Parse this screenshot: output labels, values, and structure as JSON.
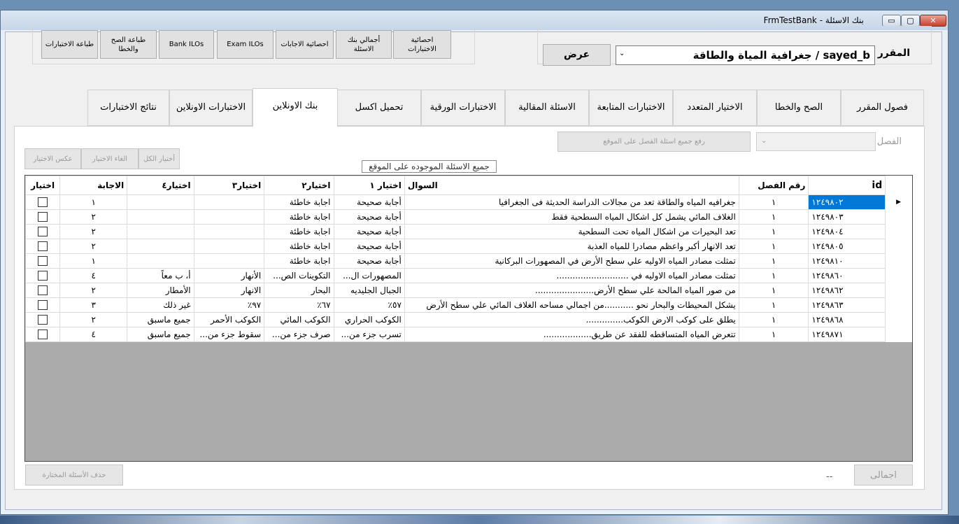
{
  "window": {
    "title": "FrmTestBank - بنك الاسئلة",
    "min": "▭",
    "max": "▢",
    "close": "✕"
  },
  "top_buttons": [
    {
      "label": "طباعة الاختبارات"
    },
    {
      "label": "طباعة الصح والخطا"
    },
    {
      "label": "Bank ILOs"
    },
    {
      "label": "Exam ILOs"
    },
    {
      "label": "احصائية الاجابات"
    },
    {
      "label": "أجمالي بنك الاسئلة"
    },
    {
      "label": "احصائية الاختبارات"
    }
  ],
  "course": {
    "label": "المقرر",
    "value": "جغرافية المياة والطاقة / sayed_b",
    "view_button": "عرض"
  },
  "tabs": [
    {
      "label": "فصول المقرر"
    },
    {
      "label": "الصح والخطا"
    },
    {
      "label": "الاختيار المتعدد"
    },
    {
      "label": "الاختبارات المتابعة"
    },
    {
      "label": "الاسئلة المقالية"
    },
    {
      "label": "الاختبارات الورقية"
    },
    {
      "label": "تحميل اكسل"
    },
    {
      "label": "بنك الاونلاين"
    },
    {
      "label": "الاختبارات الاونلاين"
    },
    {
      "label": "نتائج الاختبارات"
    }
  ],
  "active_tab": "بنك الاونلاين",
  "chapter": {
    "label": "الفصل",
    "upload_button": "رفع جميع اسئلة الفصل على الموقع"
  },
  "selection_buttons": {
    "select_all": "أختيار الكل",
    "cancel": "الغاء الاختيار",
    "invert": "عكس الاختيار"
  },
  "caption": "جميع الاسئلة الموجوده على الموقع",
  "grid": {
    "columns": [
      "id",
      "رقم الفصل",
      "السوال",
      "اختيار ١",
      "اختيار٢",
      "اختيار٣",
      "اختيار٤",
      "الاجابة",
      "اختيار"
    ],
    "row_marker": "▶",
    "rows": [
      {
        "id": "١٢٤٩٨٠٢",
        "ch": "١",
        "q": "جغرافيه المياه والطاقة تعد من مجالات الدراسة الحديثة فى الجغرافيا",
        "c1": "أجابة صحيحة",
        "c2": "اجابة خاطئة",
        "c3": "",
        "c4": "",
        "ans": "١"
      },
      {
        "id": "١٢٤٩٨٠٣",
        "ch": "١",
        "q": "الغلاف المائي يشمل كل اشكال المياه السطحية فقط",
        "c1": "أجابة صحيحة",
        "c2": "اجابة خاطئة",
        "c3": "",
        "c4": "",
        "ans": "٢"
      },
      {
        "id": "١٢٤٩٨٠٤",
        "ch": "١",
        "q": "تعد البحيرات من اشكال المياه تحت السطحية",
        "c1": "أجابة صحيحة",
        "c2": "اجابة خاطئة",
        "c3": "",
        "c4": "",
        "ans": "٢"
      },
      {
        "id": "١٢٤٩٨٠٥",
        "ch": "١",
        "q": "تعد الانهار أكبر واعظم مصادرا للمياه العذبة",
        "c1": "أجابة صحيحة",
        "c2": "اجابة خاطئة",
        "c3": "",
        "c4": "",
        "ans": "٢"
      },
      {
        "id": "١٢٤٩٨١٠",
        "ch": "١",
        "q": "تمثلت مصادر المياه الاوليه علي سطح الأرض في المصهورات البركانية",
        "c1": "أجابة صحيحة",
        "c2": "اجابة خاطئة",
        "c3": "",
        "c4": "",
        "ans": "١"
      },
      {
        "id": "١٢٤٩٨٦٠",
        "ch": "١",
        "q": "تمثلت مصادر المياه الاوليه في ...........................",
        "c1": "المصهورات ال...",
        "c2": "التكوينات الص...",
        "c3": "الأنهار",
        "c4": "أ، ب معاً",
        "ans": "٤"
      },
      {
        "id": "١٢٤٩٨٦٢",
        "ch": "١",
        "q": "من صور المياه المالحة  علي سطح الأرض......................",
        "c1": "الجبال الجليديه",
        "c2": "البحار",
        "c3": "الانهار",
        "c4": "الأمطار",
        "ans": "٢"
      },
      {
        "id": "١٢٤٩٨٦٣",
        "ch": "١",
        "q": "يشكل المحيطات والبحار نحو ...........من اجمالي مساحه الغلاف المائي علي سطح الأرض",
        "c1": "٥٧٪",
        "c2": "٦٧٪",
        "c3": "٩٧٪",
        "c4": "غير ذلك",
        "ans": "٣"
      },
      {
        "id": "١٢٤٩٨٦٨",
        "ch": "١",
        "q": "يطلق على كوكب الارض  الكوكب..............",
        "c1": "الكوكب الحراري",
        "c2": "الكوكب المائي",
        "c3": "الكوكب الأحمر",
        "c4": "جميع ماسبق",
        "ans": "٢"
      },
      {
        "id": "١٢٤٩٨٧١",
        "ch": "١",
        "q": "تتعرض المياه المتساقطه للفقد عن طريق..................",
        "c1": "تسرب جزء من...",
        "c2": "صرف جزء من...",
        "c3": "سقوط جزء من...",
        "c4": "جميع ماسبق",
        "ans": "٤"
      }
    ]
  },
  "bottom": {
    "delete_button": "حذف الأسئلة المختارة",
    "total_button": "اجمالى",
    "total_value": "--"
  }
}
